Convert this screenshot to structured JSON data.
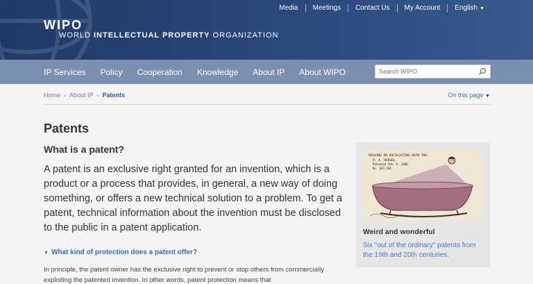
{
  "header": {
    "logo_main": "WIPO",
    "logo_sub_1": "WORLD ",
    "logo_sub_2": "INTELLECTUAL PROPERTY",
    "logo_sub_3": " ORGANIZATION",
    "toplinks": [
      "Media",
      "Meetings",
      "Contact Us",
      "My Account",
      "English"
    ]
  },
  "nav": {
    "items": [
      "IP Services",
      "Policy",
      "Cooperation",
      "Knowledge",
      "About IP",
      "About WIPO"
    ],
    "search_placeholder": "Search WIPO"
  },
  "breadcrumb": {
    "items": [
      "Home",
      "About IP",
      "Patents"
    ],
    "on_page": "On this page"
  },
  "main": {
    "title": "Patents",
    "subtitle": "What is a patent?",
    "lead": "A patent is an exclusive right granted for an invention, which is a product or a process that provides, in general, a new way of doing something, or offers a new technical solution to a problem. To get a patent, technical information about the invention must be disclosed to the public in a patent application.",
    "toggle": "What kind of protection does a patent offer?",
    "body": "In principle, the patent owner has the exclusive right to prevent or stop others from commercially exploiting the patented invention. In other words, patent protection means that"
  },
  "card": {
    "image_caption_1": "ROCKING OR OSCILLATING BATH TUB.",
    "image_caption_2": "O. A. HENSEL.",
    "image_caption_3": "Patented Feb. 6, 1900.",
    "image_caption_4": "No. 643,294.",
    "title": "Weird and wonderful",
    "description": "Six \"out of the ordinary\" patents from the 19th and 20th centuries."
  },
  "colors": {
    "header_bg": "#203a67",
    "nav_bg": "#7b8fae",
    "link": "#4a79c0"
  }
}
